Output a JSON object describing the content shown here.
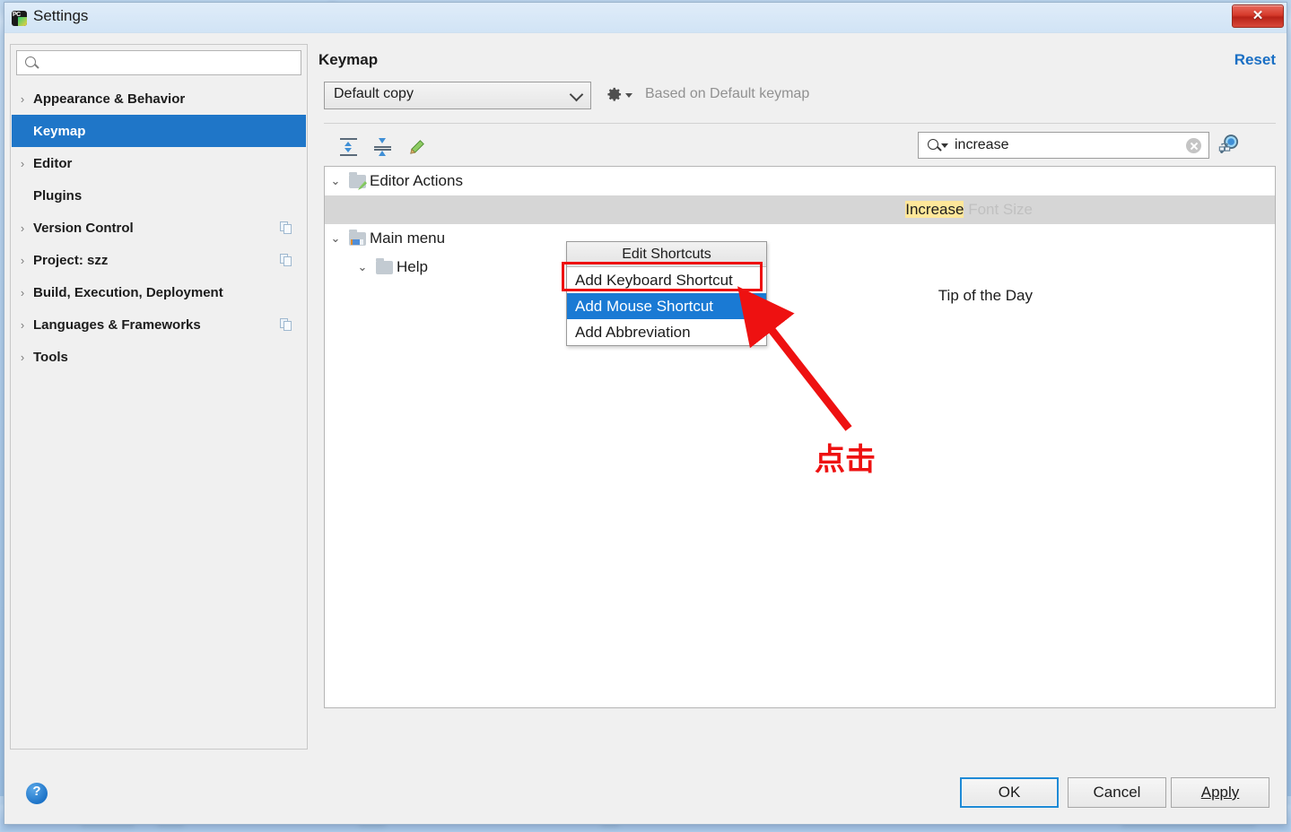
{
  "window": {
    "title": "Settings",
    "app_icon": "pycharm-icon",
    "close_label": "✕"
  },
  "sidebar": {
    "search": {
      "value": "",
      "placeholder": ""
    },
    "items": [
      {
        "label": "Appearance & Behavior",
        "expandable": true,
        "selected": false,
        "copy": false
      },
      {
        "label": "Keymap",
        "expandable": false,
        "selected": true,
        "copy": false
      },
      {
        "label": "Editor",
        "expandable": true,
        "selected": false,
        "copy": false
      },
      {
        "label": "Plugins",
        "expandable": false,
        "selected": false,
        "copy": false
      },
      {
        "label": "Version Control",
        "expandable": true,
        "selected": false,
        "copy": true
      },
      {
        "label": "Project: szz",
        "expandable": true,
        "selected": false,
        "copy": true
      },
      {
        "label": "Build, Execution, Deployment",
        "expandable": true,
        "selected": false,
        "copy": false
      },
      {
        "label": "Languages & Frameworks",
        "expandable": true,
        "selected": false,
        "copy": true
      },
      {
        "label": "Tools",
        "expandable": true,
        "selected": false,
        "copy": false
      }
    ]
  },
  "pane": {
    "title": "Keymap",
    "reset_label": "Reset",
    "keymap_select_value": "Default copy",
    "based_on": "Based on Default keymap",
    "gear_icon": "gear-icon",
    "toolbar": {
      "expand_all_icon": "expand-all-icon",
      "collapse_all_icon": "collapse-all-icon",
      "edit_icon": "pencil-edit-icon"
    },
    "tree_search": {
      "value": "increase",
      "placeholder": ""
    },
    "find_usages_icon": "find-usages-icon"
  },
  "tree": {
    "rows": [
      {
        "indent": 0,
        "twisty": "expanded",
        "icon": "editor-actions-folder",
        "text": "Editor Actions",
        "selected": false,
        "align": "left"
      },
      {
        "indent": 2,
        "twisty": "none",
        "icon": "none",
        "text_highlight": "Increase",
        "text_dim": "Font Size",
        "selected": true,
        "align": "right"
      },
      {
        "indent": 0,
        "twisty": "expanded",
        "icon": "main-menu-folder",
        "text": "Main menu",
        "selected": false,
        "align": "left"
      },
      {
        "indent": 1,
        "twisty": "expanded",
        "icon": "folder",
        "text": "Help",
        "selected": false,
        "align": "left"
      },
      {
        "indent": 2,
        "twisty": "none",
        "icon": "none",
        "text": "Tip of the Day",
        "selected": false,
        "align": "right"
      }
    ]
  },
  "context_menu": {
    "header": "Edit Shortcuts",
    "items": [
      {
        "label": "Add Keyboard Shortcut",
        "active": false
      },
      {
        "label": "Add Mouse Shortcut",
        "active": true
      },
      {
        "label": "Add Abbreviation",
        "active": false
      }
    ]
  },
  "annotation": {
    "text": "点击",
    "color": "#ee1111",
    "highlight_target": "Add Mouse Shortcut"
  },
  "footer": {
    "help_label": "?",
    "ok_label": "OK",
    "cancel_label": "Cancel",
    "apply_label": "Apply"
  },
  "colors": {
    "selection_blue": "#1f76c8",
    "menu_highlight": "#1a7ad4",
    "link_blue": "#1a6fc4",
    "annotation_red": "#ee1111",
    "search_highlight": "#ffe79a",
    "row_selected_gray": "#d6d6d6"
  }
}
